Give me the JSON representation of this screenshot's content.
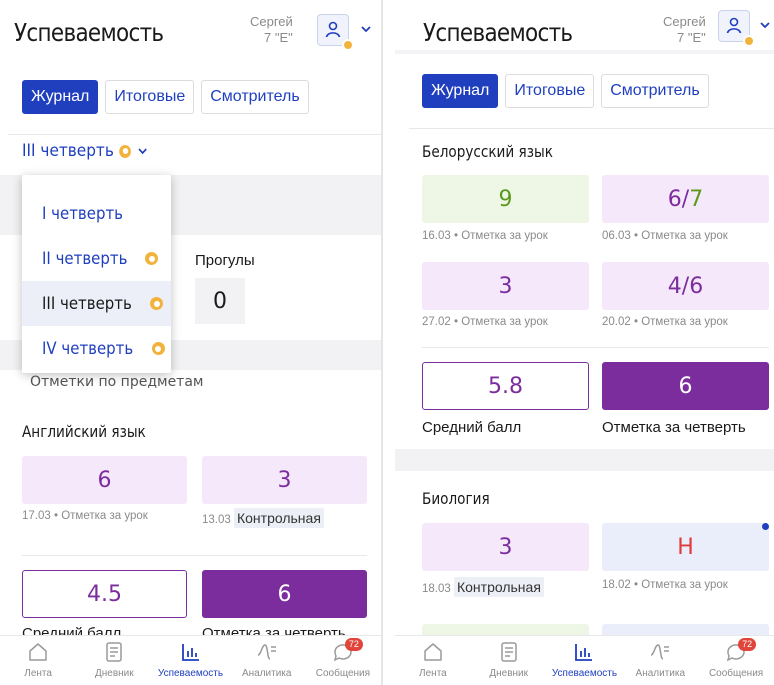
{
  "left": {
    "title": "Успеваемость",
    "user_name": "Сергей",
    "user_class": "7 \"Е\"",
    "tabs": [
      "Журнал",
      "Итоговые",
      "Смотритель"
    ],
    "quarter_selected": "III четверть",
    "dropdown": [
      "I четверть",
      "II четверть",
      "III четверть",
      "IV четверть"
    ],
    "absences_label": "Прогулы",
    "absences_value": "0",
    "section_hidden": "Отметки по предметам",
    "subject": "Английский язык",
    "marks": [
      {
        "value": "6",
        "date": "17.03",
        "type": "Отметка за урок"
      },
      {
        "value": "3",
        "date": "13.03",
        "type": "Контрольная"
      }
    ],
    "avg_value": "4.5",
    "avg_label": "Средний балл",
    "quarter_value": "6",
    "quarter_label": "Отметка за четверть"
  },
  "right": {
    "title": "Успеваемость",
    "user_name": "Сергей",
    "user_class": "7 \"Е\"",
    "tabs": [
      "Журнал",
      "Итоговые",
      "Смотритель"
    ],
    "subject1": "Белорусский язык",
    "marks1": [
      {
        "value": "9",
        "date": "16.03",
        "type": "Отметка за урок"
      },
      {
        "value": "6/7",
        "date": "06.03",
        "type": "Отметка за урок"
      },
      {
        "value": "3",
        "date": "27.02",
        "type": "Отметка за урок"
      },
      {
        "value": "4/6",
        "date": "20.02",
        "type": "Отметка за урок"
      }
    ],
    "avg_value": "5.8",
    "avg_label": "Средний балл",
    "quarter_value": "6",
    "quarter_label": "Отметка за четверть",
    "subject2": "Биология",
    "marks2": [
      {
        "value": "3",
        "date": "18.03",
        "type": "Контрольная"
      },
      {
        "value": "Н",
        "date": "18.02",
        "type": "Отметка за урок"
      }
    ]
  },
  "nav": {
    "items": [
      "Лента",
      "Дневник",
      "Успеваемость",
      "Аналитика",
      "Сообщения"
    ],
    "messages_badge": "72",
    "icons": [
      "home-icon",
      "diary-icon",
      "chart-icon",
      "analytics-icon",
      "messages-icon"
    ]
  },
  "sep": " • ",
  "colors": {
    "accent": "#1f3fbf",
    "purple": "#7b2d9e",
    "badge": "#f2b33c"
  }
}
